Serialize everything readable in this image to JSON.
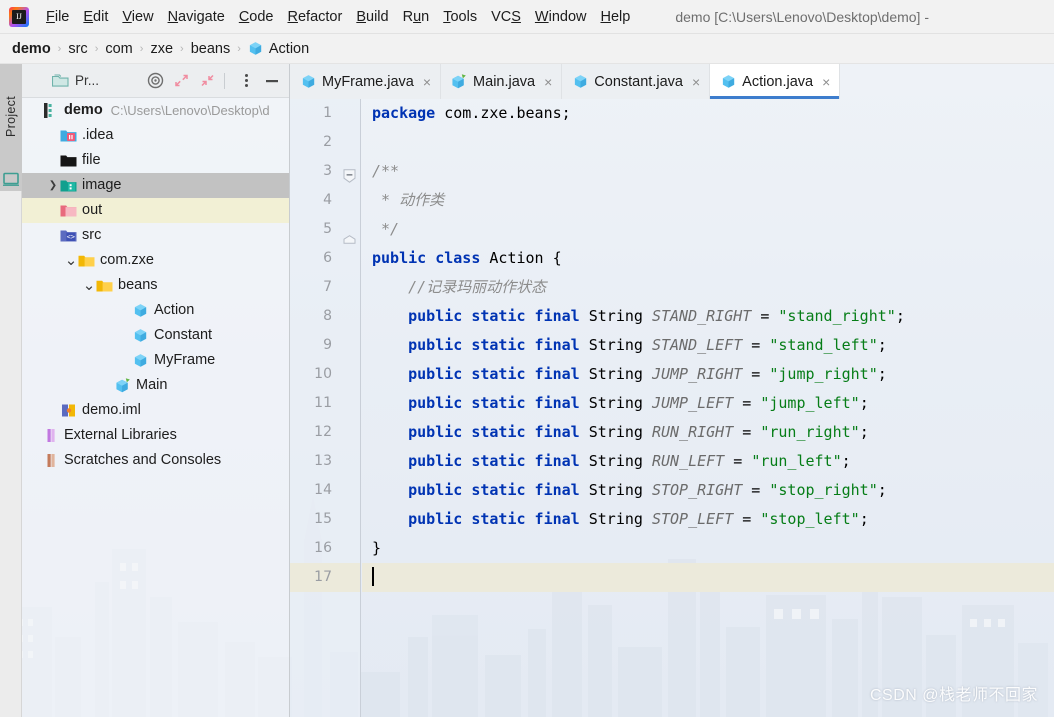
{
  "window": {
    "title": "demo [C:\\Users\\Lenovo\\Desktop\\demo] -",
    "app_icon": "intellij-idea-logo"
  },
  "menubar": {
    "items": [
      {
        "label": "File",
        "mnemonic": "F"
      },
      {
        "label": "Edit",
        "mnemonic": "E"
      },
      {
        "label": "View",
        "mnemonic": "V"
      },
      {
        "label": "Navigate",
        "mnemonic": "N"
      },
      {
        "label": "Code",
        "mnemonic": "C"
      },
      {
        "label": "Refactor",
        "mnemonic": "R"
      },
      {
        "label": "Build",
        "mnemonic": "B"
      },
      {
        "label": "Run",
        "mnemonic": "u"
      },
      {
        "label": "Tools",
        "mnemonic": "T"
      },
      {
        "label": "VCS",
        "mnemonic": "S"
      },
      {
        "label": "Window",
        "mnemonic": "W"
      },
      {
        "label": "Help",
        "mnemonic": "H"
      }
    ]
  },
  "breadcrumb": {
    "separator": "›",
    "items": [
      {
        "label": "demo",
        "bold": true,
        "icon": null
      },
      {
        "label": "src",
        "bold": false,
        "icon": null
      },
      {
        "label": "com",
        "bold": false,
        "icon": null
      },
      {
        "label": "zxe",
        "bold": false,
        "icon": null
      },
      {
        "label": "beans",
        "bold": false,
        "icon": null
      },
      {
        "label": "Action",
        "bold": false,
        "icon": "java-class-icon"
      }
    ]
  },
  "tool_strip": {
    "project_label": "Project",
    "terminal_icon": "terminal-icon"
  },
  "project_panel": {
    "title": "Pr...",
    "tools": [
      {
        "name": "locate-icon",
        "label": "Select Opened File"
      },
      {
        "name": "expand-all-icon",
        "label": "Expand All"
      },
      {
        "name": "collapse-all-icon",
        "label": "Collapse All"
      },
      {
        "name": "more-options-icon",
        "label": "Options"
      },
      {
        "name": "hide-icon",
        "label": "Hide"
      }
    ],
    "tree": [
      {
        "label": "demo",
        "path": "C:\\Users\\Lenovo\\Desktop\\d",
        "indent": 0,
        "arrow": "",
        "icon": "project-root-icon",
        "state": "normal"
      },
      {
        "label": ".idea",
        "path": "",
        "indent": 1,
        "arrow": "",
        "icon": "idea-folder-icon",
        "state": "normal"
      },
      {
        "label": "file",
        "path": "",
        "indent": 1,
        "arrow": "",
        "icon": "folder-black-icon",
        "state": "normal"
      },
      {
        "label": "image",
        "path": "",
        "indent": 1,
        "arrow": "❯",
        "icon": "resource-folder-icon",
        "state": "selected"
      },
      {
        "label": "out",
        "path": "",
        "indent": 1,
        "arrow": "",
        "icon": "excluded-folder-icon",
        "state": "excluded"
      },
      {
        "label": "src",
        "path": "",
        "indent": 1,
        "arrow": "",
        "icon": "source-folder-icon",
        "state": "normal"
      },
      {
        "label": "com.zxe",
        "path": "",
        "indent": 2,
        "arrow": "⌄",
        "icon": "package-icon",
        "state": "normal"
      },
      {
        "label": "beans",
        "path": "",
        "indent": 3,
        "arrow": "⌄",
        "icon": "package-icon",
        "state": "normal"
      },
      {
        "label": "Action",
        "path": "",
        "indent": 5,
        "arrow": "",
        "icon": "java-class-icon",
        "state": "normal"
      },
      {
        "label": "Constant",
        "path": "",
        "indent": 5,
        "arrow": "",
        "icon": "java-class-icon",
        "state": "normal"
      },
      {
        "label": "MyFrame",
        "path": "",
        "indent": 5,
        "arrow": "",
        "icon": "java-class-icon",
        "state": "normal"
      },
      {
        "label": "Main",
        "path": "",
        "indent": 4,
        "arrow": "",
        "icon": "java-main-class-icon",
        "state": "normal"
      },
      {
        "label": "demo.iml",
        "path": "",
        "indent": 1,
        "arrow": "",
        "icon": "iml-file-icon",
        "state": "normal"
      },
      {
        "label": "External Libraries",
        "path": "",
        "indent": 0,
        "arrow": "",
        "icon": "libraries-icon",
        "state": "normal"
      },
      {
        "label": "Scratches and Consoles",
        "path": "",
        "indent": 0,
        "arrow": "",
        "icon": "scratches-icon",
        "state": "normal"
      }
    ]
  },
  "editor_tabs": [
    {
      "label": "MyFrame.java",
      "icon": "java-class-icon",
      "active": false,
      "close": "×"
    },
    {
      "label": "Main.java",
      "icon": "java-main-class-icon",
      "active": false,
      "close": "×"
    },
    {
      "label": "Constant.java",
      "icon": "java-class-icon",
      "active": false,
      "close": "×"
    },
    {
      "label": "Action.java",
      "icon": "java-class-icon",
      "active": true,
      "close": "×"
    }
  ],
  "editor": {
    "active_line": 17,
    "lines": [
      {
        "n": 1,
        "fold": "",
        "tokens": [
          {
            "t": "package",
            "c": "k"
          },
          {
            "t": " com.zxe.beans;",
            "c": "id"
          }
        ]
      },
      {
        "n": 2,
        "fold": "",
        "tokens": []
      },
      {
        "n": 3,
        "fold": "collapse",
        "tokens": [
          {
            "t": "/**",
            "c": "cm"
          }
        ]
      },
      {
        "n": 4,
        "fold": "",
        "tokens": [
          {
            "t": " * 动作类",
            "c": "cm"
          }
        ]
      },
      {
        "n": 5,
        "fold": "end",
        "tokens": [
          {
            "t": " */",
            "c": "cm"
          }
        ]
      },
      {
        "n": 6,
        "fold": "",
        "tokens": [
          {
            "t": "public class ",
            "c": "k"
          },
          {
            "t": "Action {",
            "c": "id"
          }
        ]
      },
      {
        "n": 7,
        "fold": "",
        "tokens": [
          {
            "t": "    //记录玛丽动作状态",
            "c": "cm"
          }
        ]
      },
      {
        "n": 8,
        "fold": "",
        "tokens": [
          {
            "t": "    ",
            "c": "id"
          },
          {
            "t": "public static final ",
            "c": "k"
          },
          {
            "t": "String ",
            "c": "id"
          },
          {
            "t": "STAND_RIGHT",
            "c": "f"
          },
          {
            "t": " = ",
            "c": "op"
          },
          {
            "t": "\"stand_right\"",
            "c": "s"
          },
          {
            "t": ";",
            "c": "op"
          }
        ]
      },
      {
        "n": 9,
        "fold": "",
        "tokens": [
          {
            "t": "    ",
            "c": "id"
          },
          {
            "t": "public static final ",
            "c": "k"
          },
          {
            "t": "String ",
            "c": "id"
          },
          {
            "t": "STAND_LEFT",
            "c": "f"
          },
          {
            "t": " = ",
            "c": "op"
          },
          {
            "t": "\"stand_left\"",
            "c": "s"
          },
          {
            "t": ";",
            "c": "op"
          }
        ]
      },
      {
        "n": 10,
        "fold": "",
        "tokens": [
          {
            "t": "    ",
            "c": "id"
          },
          {
            "t": "public static final ",
            "c": "k"
          },
          {
            "t": "String ",
            "c": "id"
          },
          {
            "t": "JUMP_RIGHT",
            "c": "f"
          },
          {
            "t": " = ",
            "c": "op"
          },
          {
            "t": "\"jump_right\"",
            "c": "s"
          },
          {
            "t": ";",
            "c": "op"
          }
        ]
      },
      {
        "n": 11,
        "fold": "",
        "tokens": [
          {
            "t": "    ",
            "c": "id"
          },
          {
            "t": "public static final ",
            "c": "k"
          },
          {
            "t": "String ",
            "c": "id"
          },
          {
            "t": "JUMP_LEFT",
            "c": "f"
          },
          {
            "t": " = ",
            "c": "op"
          },
          {
            "t": "\"jump_left\"",
            "c": "s"
          },
          {
            "t": ";",
            "c": "op"
          }
        ]
      },
      {
        "n": 12,
        "fold": "",
        "tokens": [
          {
            "t": "    ",
            "c": "id"
          },
          {
            "t": "public static final ",
            "c": "k"
          },
          {
            "t": "String ",
            "c": "id"
          },
          {
            "t": "RUN_RIGHT",
            "c": "f"
          },
          {
            "t": " = ",
            "c": "op"
          },
          {
            "t": "\"run_right\"",
            "c": "s"
          },
          {
            "t": ";",
            "c": "op"
          }
        ]
      },
      {
        "n": 13,
        "fold": "",
        "tokens": [
          {
            "t": "    ",
            "c": "id"
          },
          {
            "t": "public static final ",
            "c": "k"
          },
          {
            "t": "String ",
            "c": "id"
          },
          {
            "t": "RUN_LEFT",
            "c": "f"
          },
          {
            "t": " = ",
            "c": "op"
          },
          {
            "t": "\"run_left\"",
            "c": "s"
          },
          {
            "t": ";",
            "c": "op"
          }
        ]
      },
      {
        "n": 14,
        "fold": "",
        "tokens": [
          {
            "t": "    ",
            "c": "id"
          },
          {
            "t": "public static final ",
            "c": "k"
          },
          {
            "t": "String ",
            "c": "id"
          },
          {
            "t": "STOP_RIGHT",
            "c": "f"
          },
          {
            "t": " = ",
            "c": "op"
          },
          {
            "t": "\"stop_right\"",
            "c": "s"
          },
          {
            "t": ";",
            "c": "op"
          }
        ]
      },
      {
        "n": 15,
        "fold": "",
        "tokens": [
          {
            "t": "    ",
            "c": "id"
          },
          {
            "t": "public static final ",
            "c": "k"
          },
          {
            "t": "String ",
            "c": "id"
          },
          {
            "t": "STOP_LEFT",
            "c": "f"
          },
          {
            "t": " = ",
            "c": "op"
          },
          {
            "t": "\"stop_left\"",
            "c": "s"
          },
          {
            "t": ";",
            "c": "op"
          }
        ]
      },
      {
        "n": 16,
        "fold": "",
        "tokens": [
          {
            "t": "}",
            "c": "id"
          }
        ]
      },
      {
        "n": 17,
        "fold": "",
        "tokens": [],
        "caret": true
      }
    ]
  },
  "watermark": {
    "text": "CSDN @栈老师不回家"
  },
  "colors": {
    "accent": "#3d7dcd",
    "keyword": "#0033b3",
    "string": "#067d17",
    "comment": "#8c8c8c",
    "static_field": "#6b6b6b",
    "selection": "#c2c2c2",
    "excluded": "#f2f0d5",
    "caret_line": "#eceadb"
  }
}
